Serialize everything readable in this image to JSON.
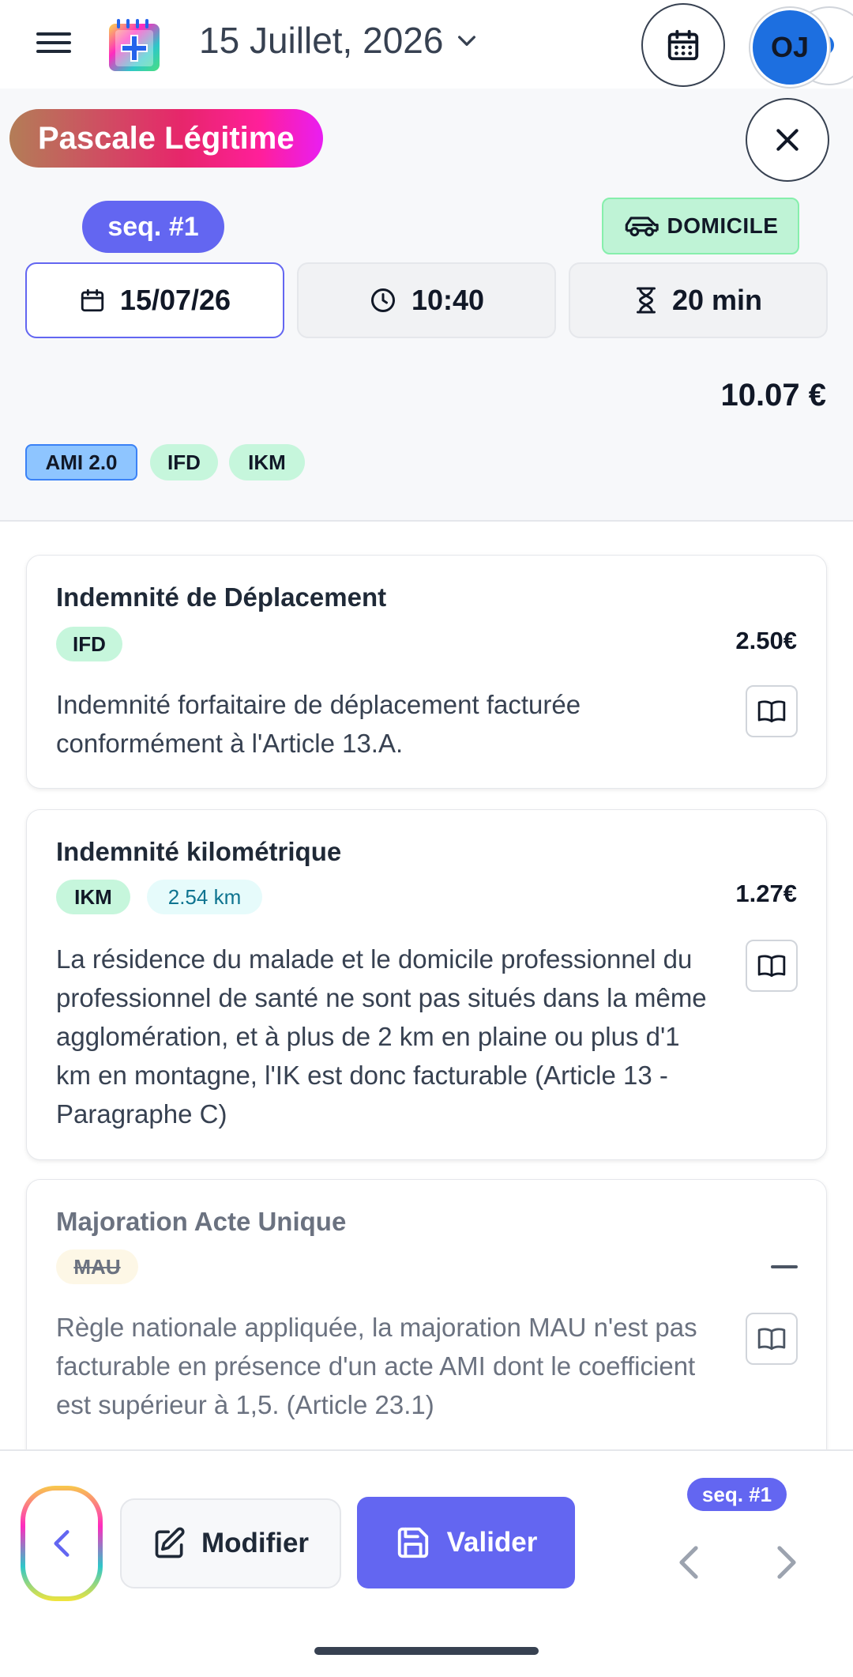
{
  "header": {
    "date_title": "15 Juillet, 2026",
    "avatar_initials": "OJ"
  },
  "patient": {
    "name": "Pascale Légitime"
  },
  "visit": {
    "seq_label": "seq. #1",
    "location_label": "DOMICILE",
    "date": "15/07/26",
    "time": "10:40",
    "duration": "20 min",
    "total": "10.07 €",
    "tags": [
      "AMI 2.0",
      "IFD",
      "IKM"
    ]
  },
  "cards": [
    {
      "title": "Indemnité de Déplacement",
      "code": "IFD",
      "amount": "2.50€",
      "description": "Indemnité forfaitaire de déplacement facturée conformément à l'Article 13.A."
    },
    {
      "title": "Indemnité kilométrique",
      "code": "IKM",
      "distance": "2.54 km",
      "amount": "1.27€",
      "description": "La résidence du malade et le domicile professionnel du professionnel de santé ne sont pas situés dans la même agglomération, et à plus de 2 km en plaine ou plus d'1 km en montagne, l'IK est donc facturable (Article 13 - Paragraphe C)"
    },
    {
      "title": "Majoration Acte Unique",
      "code": "MAU",
      "description": "Règle nationale appliquée, la majoration MAU n'est pas facturable en présence d'un acte AMI dont le coefficient est supérieur à 1,5. (Article 23.1)"
    }
  ],
  "bottom_bar": {
    "modify_label": "Modifier",
    "validate_label": "Valider",
    "seq_label": "seq. #1"
  },
  "colors": {
    "accent": "#6366f1",
    "avatar": "#1d6fe0",
    "code_badge": "#c6f6dc",
    "domicile_badge": "#bff3d6"
  }
}
